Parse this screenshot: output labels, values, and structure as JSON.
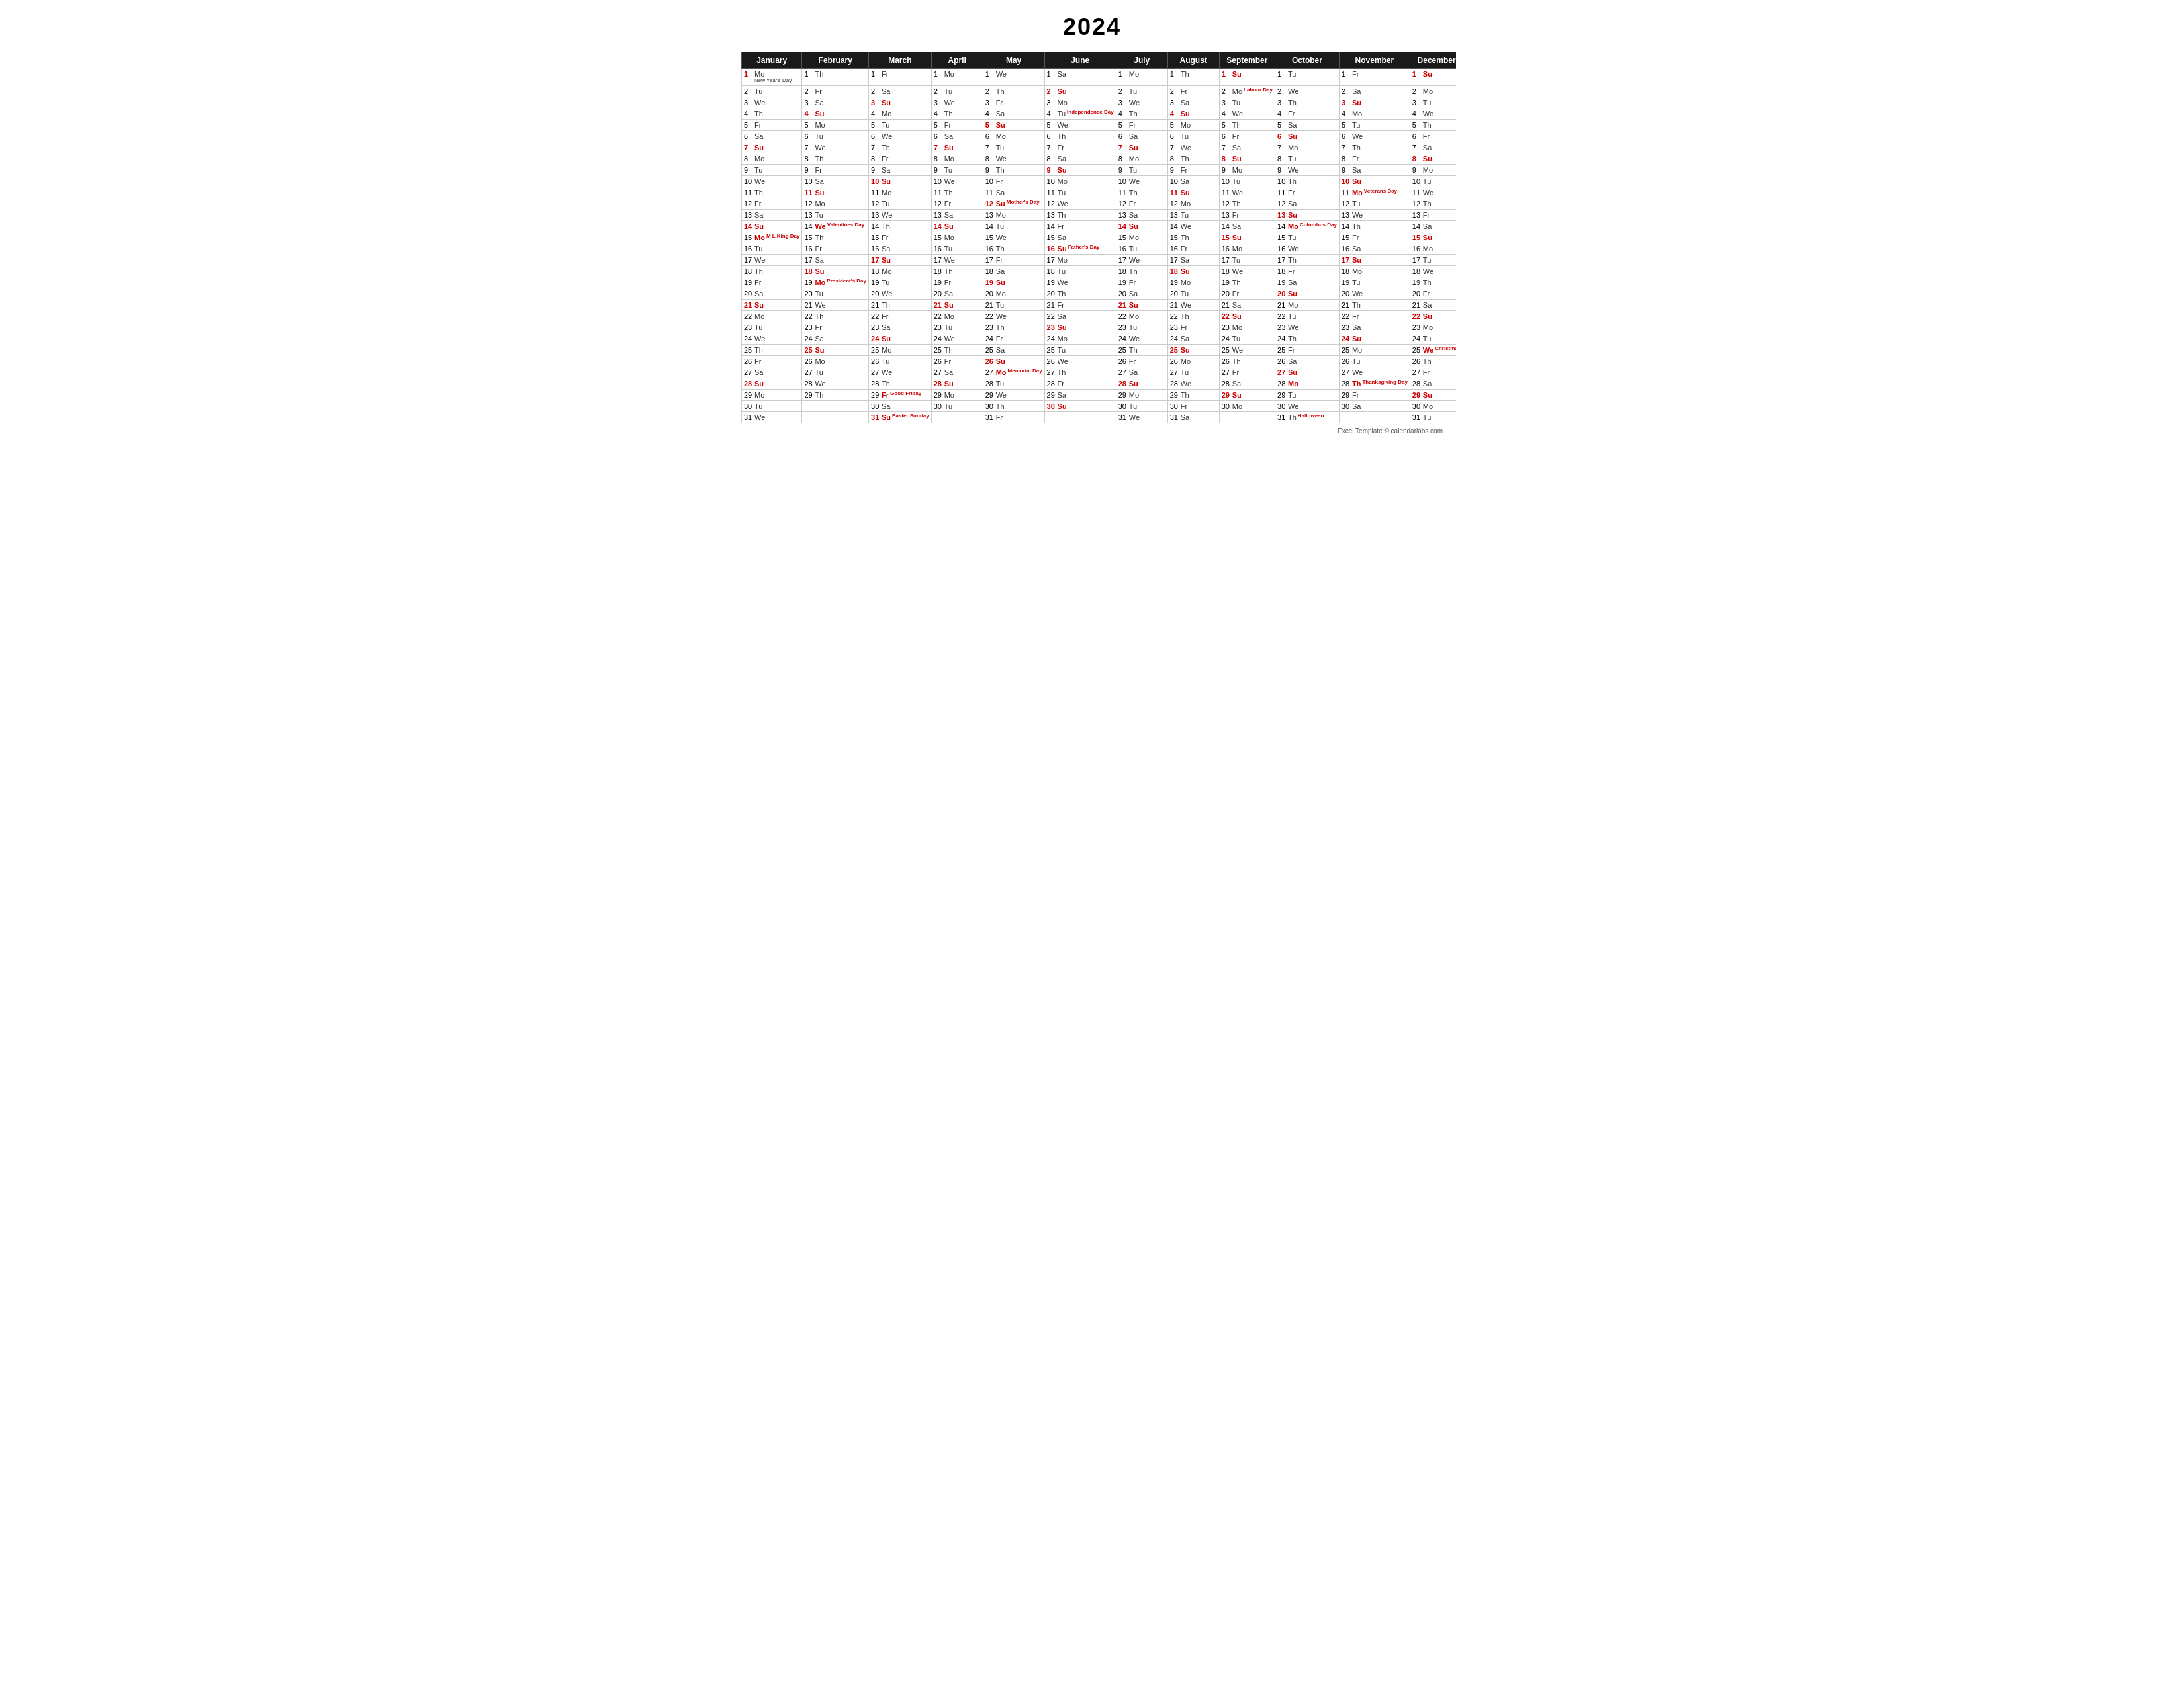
{
  "title": "2024",
  "months": [
    {
      "name": "January",
      "col": 0
    },
    {
      "name": "February",
      "col": 1
    },
    {
      "name": "March",
      "col": 2
    },
    {
      "name": "April",
      "col": 3
    },
    {
      "name": "May",
      "col": 4
    },
    {
      "name": "June",
      "col": 5
    },
    {
      "name": "July",
      "col": 6
    },
    {
      "name": "August",
      "col": 7
    },
    {
      "name": "September",
      "col": 8
    },
    {
      "name": "October",
      "col": 9
    },
    {
      "name": "November",
      "col": 10
    },
    {
      "name": "December",
      "col": 11
    }
  ],
  "footer": "Excel Template © calendarlabs.com"
}
